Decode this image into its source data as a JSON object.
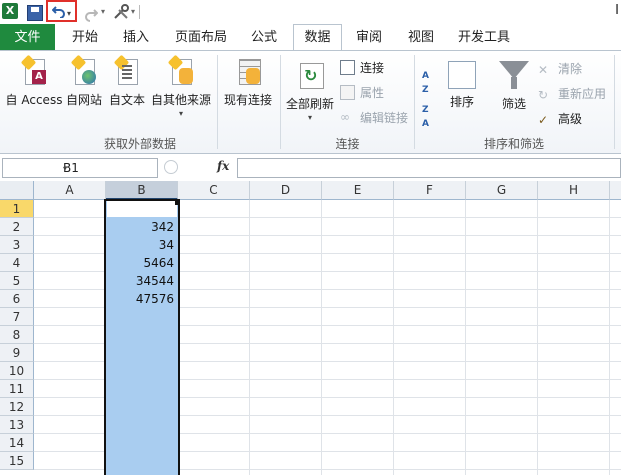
{
  "app": {
    "logo_letter": "X",
    "title_fragment": "I"
  },
  "qat": {
    "dropdown_glyph": "▾"
  },
  "tabs": [
    {
      "label": "文件"
    },
    {
      "label": "开始"
    },
    {
      "label": "插入"
    },
    {
      "label": "页面布局"
    },
    {
      "label": "公式"
    },
    {
      "label": "数据"
    },
    {
      "label": "审阅"
    },
    {
      "label": "视图"
    },
    {
      "label": "开发工具"
    }
  ],
  "active_tab": "数据",
  "ribbon": {
    "external": {
      "buttons": [
        "自 Access",
        "自网站",
        "自文本",
        "自其他来源"
      ],
      "more_arrow": "▾",
      "existing": "现有连接",
      "label": "获取外部数据"
    },
    "connections": {
      "refresh_all": "全部刷新",
      "refresh_arrow": "▾",
      "connections": "连接",
      "properties": "属性",
      "edit_links": "编辑链接",
      "label": "连接"
    },
    "sort": {
      "az": "A\nZ",
      "za": "Z\nA",
      "sort": "排序",
      "filter": "筛选",
      "clear": "清除",
      "reapply": "重新应用",
      "advanced": "高级",
      "label": "排序和筛选"
    }
  },
  "formula_bar": {
    "name_box": "B1",
    "fx": "fx",
    "formula": ""
  },
  "grid": {
    "columns": [
      "A",
      "B",
      "C",
      "D",
      "E",
      "F",
      "G",
      "H"
    ],
    "selected_column": "B",
    "rows": [
      "1",
      "2",
      "3",
      "4",
      "5",
      "6",
      "7",
      "8",
      "9",
      "10",
      "11",
      "12",
      "13",
      "14",
      "15"
    ],
    "selected_row": "1",
    "values_column_B": [
      {
        "row": "2",
        "value": "342"
      },
      {
        "row": "3",
        "value": "34"
      },
      {
        "row": "4",
        "value": "5464"
      },
      {
        "row": "5",
        "value": "34544"
      },
      {
        "row": "6",
        "value": "47576"
      }
    ]
  },
  "colors": {
    "accent_file_tab": "#1f8a3e",
    "selection": "#a9cdf0",
    "highlight_box": "#e0302a"
  }
}
